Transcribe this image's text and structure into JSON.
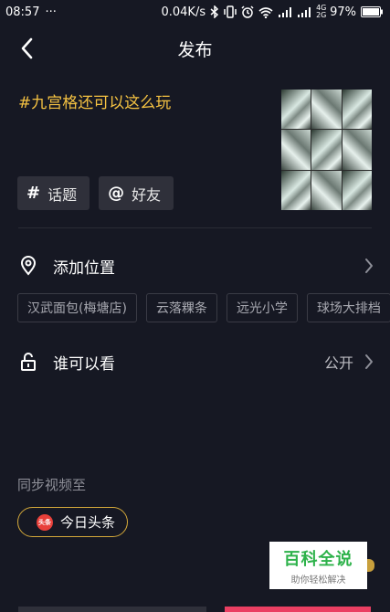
{
  "status_bar": {
    "time": "08:57",
    "more": "···",
    "network_speed": "0.04K/s",
    "network_types": "4G 2G",
    "battery_percent": "97%"
  },
  "header": {
    "title": "发布"
  },
  "post": {
    "caption": "#九宫格还可以这么玩"
  },
  "chips": [
    {
      "symbol": "#",
      "label": "话题"
    },
    {
      "symbol": "@",
      "label": "好友"
    }
  ],
  "location": {
    "label": "添加位置",
    "tags": [
      "汉武面包(梅塘店)",
      "云落粿条",
      "远光小学",
      "球场大排档"
    ]
  },
  "visibility": {
    "label": "谁可以看",
    "value": "公开"
  },
  "sync": {
    "label": "同步视频至",
    "button_label": "今日头条",
    "badge_text": "头条"
  },
  "watermark": {
    "title": "百科全说",
    "subtitle": "助你轻松解决"
  },
  "colors": {
    "background": "#161823",
    "caption": "#f5c242",
    "accent": "#ea3f62"
  }
}
